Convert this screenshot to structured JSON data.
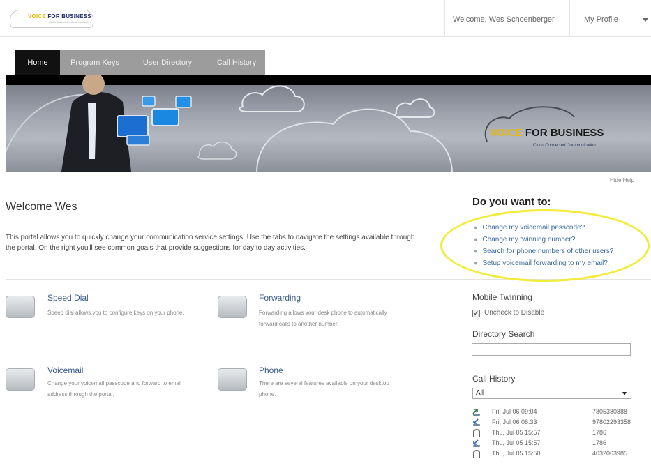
{
  "header": {
    "logo_brand_a": "VOICE",
    "logo_brand_b": "FOR BUSINESS",
    "logo_tagline": "Cloud Connected Communication",
    "welcome_text": "Welcome, Wes Schoenberger",
    "profile_label": "My Profile"
  },
  "tabs": [
    {
      "label": "Home",
      "active": true
    },
    {
      "label": "Program Keys",
      "active": false
    },
    {
      "label": "User Directory",
      "active": false
    },
    {
      "label": "Call History",
      "active": false
    }
  ],
  "banner": {
    "brand_a": "VOICE",
    "brand_b": "FOR BUSINESS",
    "tagline": "Cloud Connected Communication"
  },
  "hide_help": "Hide Help",
  "main": {
    "title": "Welcome Wes",
    "intro": "This portal allows you to quickly change your communication service settings. Use the tabs to navigate the settings available through the portal. On the right you'll see common goals that provide suggestions for day to day activities."
  },
  "features": [
    {
      "title": "Speed Dial",
      "desc": "Speed dial allows you to configure keys on your phone."
    },
    {
      "title": "Forwarding",
      "desc": "Forwarding allows your desk phone to automatically forward calls to another number."
    },
    {
      "title": "Voicemail",
      "desc": "Change your voicemail passcode and forward to email address through the portal."
    },
    {
      "title": "Phone",
      "desc": "There are several features available on your desktop phone."
    }
  ],
  "help": {
    "title": "Do you want to:",
    "items": [
      "Change my voicemail passcode?",
      "Change my twinning number?",
      "Search for phone numbers of other users?",
      "Setup voicemail forwarding to my email?"
    ]
  },
  "sidebar": {
    "mobile_twinning": {
      "title": "Mobile Twinning",
      "checkbox_label": "Uncheck to Disable",
      "checked": true
    },
    "directory_search": {
      "title": "Directory Search",
      "value": ""
    },
    "call_history": {
      "title": "Call History",
      "filter": "All",
      "calls": [
        {
          "date": "Fri, Jul 06 09:04",
          "number": "7805380888",
          "kind": "outgoing"
        },
        {
          "date": "Fri, Jul 06 08:33",
          "number": "97802293358",
          "kind": "incoming"
        },
        {
          "date": "Thu, Jul 05 15:57",
          "number": "1786",
          "kind": "missed"
        },
        {
          "date": "Thu, Jul 05 15:57",
          "number": "1786",
          "kind": "incoming"
        },
        {
          "date": "Thu, Jul 05 15:50",
          "number": "4032063985",
          "kind": "missed"
        }
      ]
    }
  },
  "colors": {
    "accent": "#3b6aa0",
    "brand_yellow": "#e9b800",
    "brand_navy": "#1f2f6e",
    "highlight": "#f1ec3a"
  }
}
